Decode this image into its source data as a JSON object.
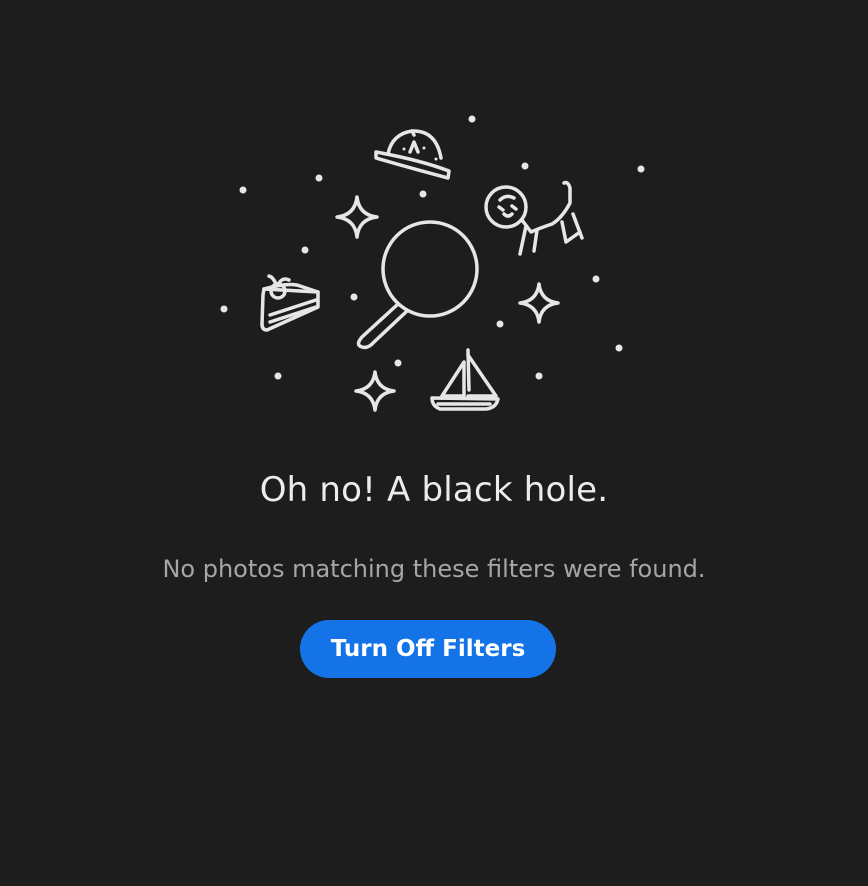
{
  "empty_state": {
    "title": "Oh no! A black hole.",
    "message": "No photos matching these filters were found.",
    "button_label": "Turn Off Filters"
  },
  "theme": {
    "background": "#1d1d1d",
    "illustration_stroke": "#e6e6e6",
    "title_color": "#ececec",
    "message_color": "#a6a6a6",
    "button_color": "#1473e6",
    "button_text_color": "#ffffff"
  },
  "illustration": {
    "icons": [
      "ufo-icon",
      "astronaut-dog-icon",
      "magnifier-icon",
      "cake-slice-icon",
      "sailboat-icon",
      "sparkle-icon",
      "star-dot-icon"
    ]
  }
}
